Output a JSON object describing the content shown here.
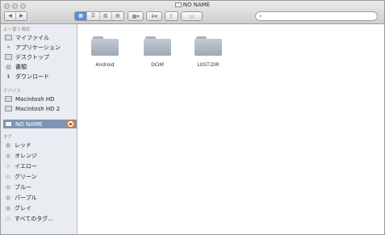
{
  "window": {
    "title": "NO NAME"
  },
  "toolbar": {
    "back_icon": "chevron-left-icon",
    "forward_icon": "chevron-right-icon",
    "view_icons": "icon-view",
    "view_list": "list-view",
    "view_columns": "column-view",
    "view_coverflow": "coverflow-view",
    "arrange_label": "▾",
    "action_label": "▾",
    "search_placeholder": ""
  },
  "sidebar": {
    "favorites_title": "よく使う項目",
    "favorites": [
      {
        "label": "マイファイル",
        "icon": "all-files-icon"
      },
      {
        "label": "アプリケーション",
        "icon": "applications-icon"
      },
      {
        "label": "デスクトップ",
        "icon": "desktop-icon"
      },
      {
        "label": "書類",
        "icon": "documents-icon"
      },
      {
        "label": "ダウンロード",
        "icon": "downloads-icon"
      }
    ],
    "devices_title": "デバイス",
    "devices": [
      {
        "label": "Macintosh HD",
        "icon": "hard-drive-icon"
      },
      {
        "label": "Macintosh HD 2",
        "icon": "hard-drive-icon"
      },
      {
        "label": "NO NAME",
        "icon": "removable-drive-icon",
        "selected": true
      }
    ],
    "tags_title": "タグ",
    "tags": [
      {
        "label": "レッド",
        "color": "#b8b8b8"
      },
      {
        "label": "オレンジ",
        "color": "#c4c4c4"
      },
      {
        "label": "イエロー",
        "color": "#dcdcdc"
      },
      {
        "label": "グリーン",
        "color": "#d4d4d4"
      },
      {
        "label": "ブルー",
        "color": "#c8c8c8"
      },
      {
        "label": "パープル",
        "color": "#c0c0c0"
      },
      {
        "label": "グレイ",
        "color": "#bdbdbd"
      },
      {
        "label": "すべてのタグ...",
        "color": "#e4e4e4"
      }
    ]
  },
  "content": {
    "folders": [
      {
        "name": "Android"
      },
      {
        "name": "DCIM"
      },
      {
        "name": "LOST.DIR"
      }
    ]
  },
  "colors": {
    "selection": "#7d95b8",
    "eject_highlight": "#ef7b22"
  }
}
